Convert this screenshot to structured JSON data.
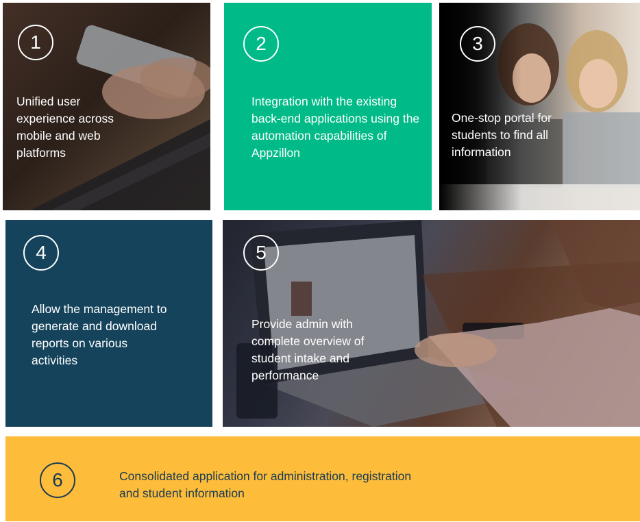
{
  "tiles": [
    {
      "number": "1",
      "text": "Unified user experience across mobile and web platforms",
      "background": "photo"
    },
    {
      "number": "2",
      "text": "Integration with the existing back-end applications using the automation capabilities of Appzillon",
      "color": "#00bb88"
    },
    {
      "number": "3",
      "text": "One-stop portal for students to find all information",
      "background": "photo"
    },
    {
      "number": "4",
      "text": "Allow the management to generate and download reports on various activities",
      "color": "#14435b"
    },
    {
      "number": "5",
      "text": "Provide admin with complete overview of student intake and performance",
      "background": "photo"
    },
    {
      "number": "6",
      "text": "Consolidated application for administration, registration and student information",
      "color": "#fdbc3a",
      "text_color": "#1a3b52"
    }
  ]
}
